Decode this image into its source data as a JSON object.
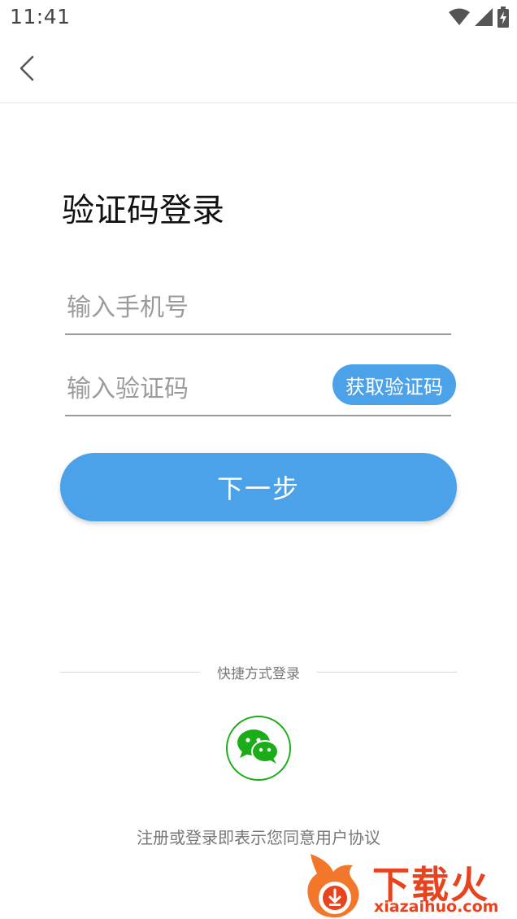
{
  "status_bar": {
    "time": "11:41",
    "icons": [
      "wifi-icon",
      "signal-icon",
      "battery-charging-icon"
    ]
  },
  "nav": {
    "back_icon": "chevron-left-icon"
  },
  "page": {
    "title": "验证码登录"
  },
  "form": {
    "phone_placeholder": "输入手机号",
    "phone_value": "",
    "code_placeholder": "输入验证码",
    "code_value": "",
    "get_code_label": "获取验证码",
    "next_label": "下一步"
  },
  "quick_login": {
    "label": "快捷方式登录",
    "options": [
      "wechat-icon"
    ]
  },
  "agreement": {
    "prefix": "注册或登录即表示您同意",
    "link": "用户协议"
  },
  "watermark": {
    "title": "下载火",
    "url": "xiazaihuo.com"
  },
  "colors": {
    "accent": "#4ba2e8",
    "wechat_green": "#1aad19",
    "watermark_orange": "#e8431f"
  }
}
